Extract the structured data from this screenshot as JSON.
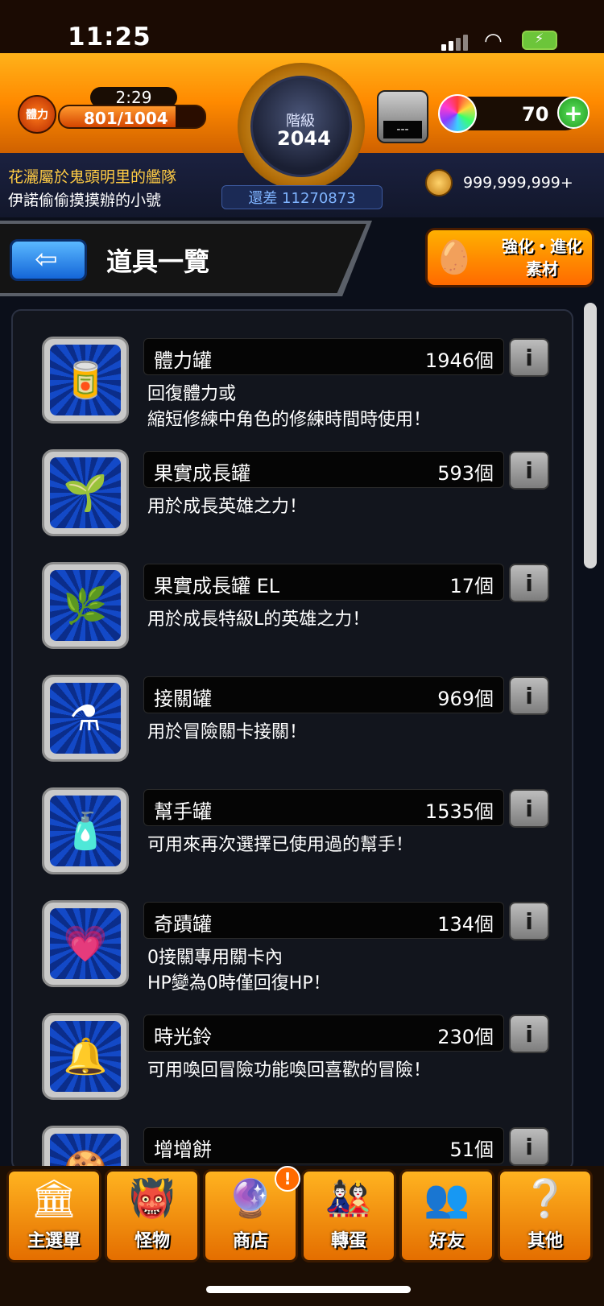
{
  "status_bar": {
    "time": "11:25"
  },
  "header": {
    "stamina_label": "體力",
    "stamina_timer": "2:29",
    "stamina_value": "801/1004",
    "rank_label": "階級",
    "rank_value": "2044",
    "next_rank": "還差 11270873",
    "team_line1": "花灑屬於鬼頭明里的艦隊",
    "team_line2": "伊諾偷偷摸摸辦的小號",
    "counter_display": "---",
    "orbs": "70",
    "gold": "999,999,999+"
  },
  "title_bar": {
    "title": "道具一覽",
    "enhance_label": "強化・進化\n素材"
  },
  "items": [
    {
      "name": "體力罐",
      "count": "1946個",
      "desc": "回復體力或\n縮短修練中角色的修練時間時使用！",
      "icon": "stamina-can-icon",
      "glyph": "🥫"
    },
    {
      "name": "果實成長罐",
      "count": "593個",
      "desc": "用於成長英雄之力！",
      "icon": "fruit-growth-can-icon",
      "glyph": "🌱"
    },
    {
      "name": "果實成長罐 EL",
      "count": "17個",
      "desc": "用於成長特級L的英雄之力！",
      "icon": "fruit-growth-can-el-icon",
      "glyph": "🌿"
    },
    {
      "name": "接關罐",
      "count": "969個",
      "desc": "用於冒險關卡接關！",
      "icon": "continue-can-icon",
      "glyph": "⚗"
    },
    {
      "name": "幫手罐",
      "count": "1535個",
      "desc": "可用來再次選擇已使用過的幫手！",
      "icon": "helper-can-icon",
      "glyph": "🧴"
    },
    {
      "name": "奇蹟罐",
      "count": "134個",
      "desc": "0接關專用關卡內\nHP變為0時僅回復HP！",
      "icon": "miracle-can-icon",
      "glyph": "💗"
    },
    {
      "name": "時光鈴",
      "count": "230個",
      "desc": "可用喚回冒險功能喚回喜歡的冒險！",
      "icon": "time-bell-icon",
      "glyph": "🔔"
    },
    {
      "name": "增增餅",
      "count": "51個",
      "desc": "",
      "icon": "boost-cookie-icon",
      "glyph": "🍪"
    }
  ],
  "nav": [
    {
      "label": "主選單",
      "icon": "main-menu-icon",
      "glyph": "🏛"
    },
    {
      "label": "怪物",
      "icon": "monster-icon",
      "glyph": "👹"
    },
    {
      "label": "商店",
      "icon": "shop-orb-icon",
      "glyph": "🔮"
    },
    {
      "label": "轉蛋",
      "icon": "gacha-icon",
      "glyph": "🎎"
    },
    {
      "label": "好友",
      "icon": "friends-icon",
      "glyph": "👥"
    },
    {
      "label": "其他",
      "icon": "other-icon",
      "glyph": "❔"
    }
  ],
  "colors": {
    "banner": "#ff8a00",
    "panel": "#12151d",
    "accent_blue": "#1466d8",
    "plus_green": "#2fbf3a"
  }
}
